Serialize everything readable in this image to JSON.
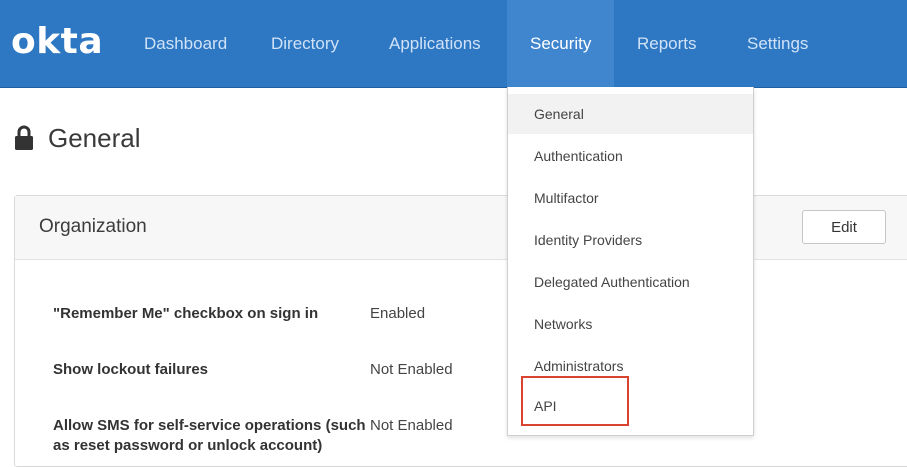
{
  "app": {
    "logo_text": "okta"
  },
  "nav": {
    "dashboard": "Dashboard",
    "directory": "Directory",
    "applications": "Applications",
    "security": "Security",
    "reports": "Reports",
    "settings": "Settings"
  },
  "page": {
    "title": "General",
    "icon": "lock-icon"
  },
  "panel": {
    "title": "Organization",
    "edit_label": "Edit",
    "rows": [
      {
        "label": "\"Remember Me\" checkbox on sign in",
        "value": "Enabled"
      },
      {
        "label": "Show lockout failures",
        "value": "Not Enabled"
      },
      {
        "label": "Allow SMS for self-service operations (such as reset password or unlock account)",
        "value": "Not Enabled"
      }
    ]
  },
  "security_menu": {
    "items": [
      "General",
      "Authentication",
      "Multifactor",
      "Identity Providers",
      "Delegated Authentication",
      "Networks",
      "Administrators",
      "API"
    ],
    "hovered": "General",
    "highlighted": "API"
  },
  "colors": {
    "nav_bg": "#2e77c3",
    "nav_active": "#3f86cf",
    "highlight": "#d9432f"
  }
}
